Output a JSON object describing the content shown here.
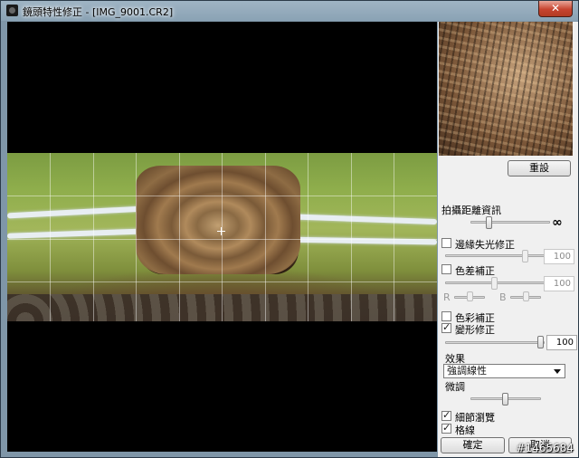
{
  "window": {
    "title": "鏡頭特性修正 - [IMG_9001.CR2]",
    "close_symbol": "✕"
  },
  "panel": {
    "reset_label": "重設",
    "shooting_distance_label": "拍攝距離資訊",
    "infinity_symbol": "∞",
    "peripheral_illumination": {
      "label": "邊緣失光修正",
      "checked": false,
      "value": "100"
    },
    "chromatic_aberration": {
      "label": "色差補正",
      "checked": false,
      "value": "100",
      "r_label": "R",
      "b_label": "B"
    },
    "color_blur": {
      "label": "色彩補正",
      "checked": false
    },
    "distortion": {
      "label": "變形修正",
      "checked": true,
      "value": "100"
    },
    "effect_label": "效果",
    "effect_selected": "強調線性",
    "fine_tune_label": "微調",
    "detail_view": {
      "label": "細節瀏覽",
      "checked": true
    },
    "grid": {
      "label": "格線",
      "checked": true
    },
    "ok_label": "確定",
    "cancel_label": "取消"
  },
  "watermark": "#1465684"
}
